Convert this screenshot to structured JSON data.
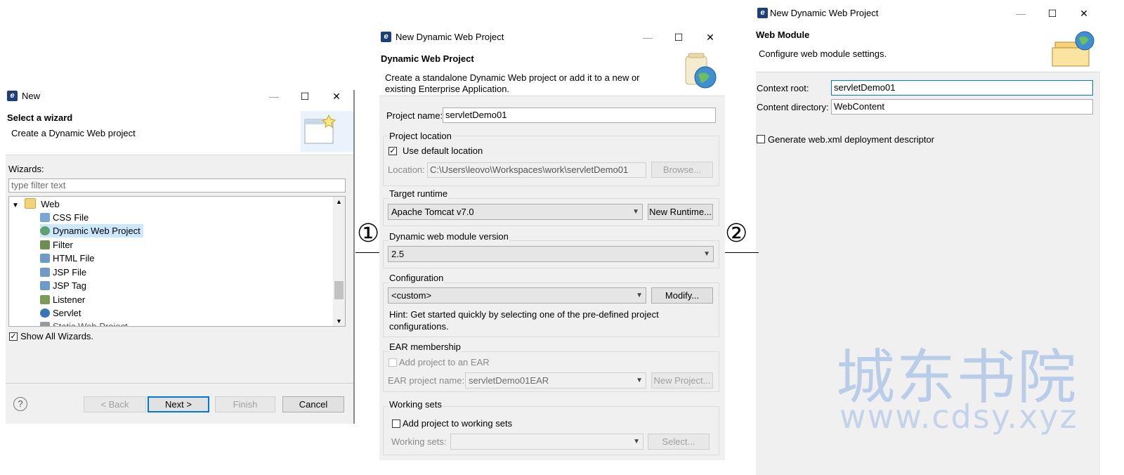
{
  "colors": {
    "accent": "#0078d7",
    "selection": "#cce8ff",
    "watermark": "#b9cde8"
  },
  "w1": {
    "title": "New",
    "header_title": "Select a wizard",
    "header_desc": "Create a Dynamic Web project",
    "wizards_label": "Wizards:",
    "filter_placeholder": "type filter text",
    "tree": {
      "root": "Web",
      "items": [
        "CSS File",
        "Dynamic Web Project",
        "Filter",
        "HTML File",
        "JSP File",
        "JSP Tag",
        "Listener",
        "Servlet"
      ],
      "partial": "Static Web Project"
    },
    "show_all": "Show All Wizards.",
    "help_glyph": "?",
    "buttons": {
      "back": "< Back",
      "next": "Next >",
      "finish": "Finish",
      "cancel": "Cancel"
    }
  },
  "w2": {
    "title": "New Dynamic Web Project",
    "header_title": "Dynamic Web Project",
    "header_desc1": "Create a standalone Dynamic Web project or add it to a new or",
    "header_desc2": "existing Enterprise Application.",
    "project_name_label": "Project name:",
    "project_name_value": "servletDemo01",
    "location_group": "Project location",
    "use_default": "Use default location",
    "location_label": "Location:",
    "location_value": "C:\\Users\\leovo\\Workspaces\\work\\servletDemo01",
    "browse": "Browse...",
    "target_group": "Target runtime",
    "target_value": "Apache Tomcat v7.0",
    "new_runtime": "New Runtime...",
    "module_group": "Dynamic web module version",
    "module_value": "2.5",
    "config_group": "Configuration",
    "config_value": "<custom>",
    "modify": "Modify...",
    "hint1": "Hint: Get started quickly by selecting one of the pre-defined project",
    "hint2": "configurations.",
    "ear_group": "EAR membership",
    "add_ear": "Add project to an EAR",
    "ear_label": "EAR project name:",
    "ear_value": "servletDemo01EAR",
    "new_project": "New Project...",
    "ws_group": "Working sets",
    "add_ws": "Add project to working sets",
    "ws_label": "Working sets:",
    "select": "Select..."
  },
  "w3": {
    "title": "New Dynamic Web Project",
    "header_title": "Web Module",
    "header_desc": "Configure web module settings.",
    "context_label": "Context root:",
    "context_value": "servletDemo01",
    "content_label": "Content directory:",
    "content_value": "WebContent",
    "gen_xml": "Generate web.xml deployment descriptor"
  },
  "annotations": {
    "one": "①",
    "two": "②"
  },
  "watermark": {
    "line1": "城东书院",
    "line2": "www.cdsy.xyz"
  },
  "window_controls": {
    "minimize": "—",
    "maximize": "☐",
    "close": "✕"
  }
}
